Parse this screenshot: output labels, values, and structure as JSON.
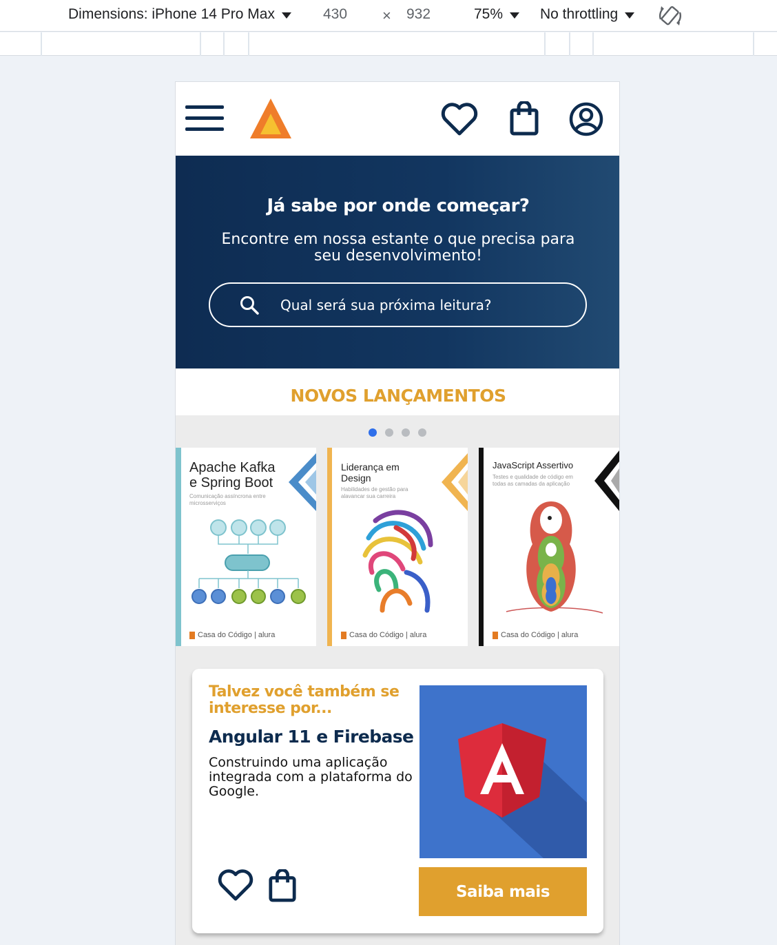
{
  "devtools": {
    "dimensions_label": "Dimensions: iPhone 14 Pro Max",
    "width": "430",
    "times": "×",
    "height": "932",
    "zoom": "75%",
    "throttling": "No throttling",
    "rotate_icon": "rotate-icon"
  },
  "header": {
    "menu_icon": "hamburger-menu-icon",
    "logo_icon": "triangle-logo-icon",
    "favorites_icon": "heart-icon",
    "bag_icon": "shopping-bag-icon",
    "profile_icon": "user-circle-icon"
  },
  "hero": {
    "title": "Já sabe por onde começar?",
    "subtitle": "Encontre em nossa estante o que precisa para seu desenvolvimento!",
    "search_placeholder": "Qual será sua próxima leitura?"
  },
  "releases": {
    "title": "NOVOS LANÇAMENTOS",
    "dots": 4,
    "active_dot": 0,
    "books": [
      {
        "title_line1": "Apache Kafka",
        "title_line2": "e Spring Boot",
        "subtitle": "Comunicação assíncrona entre microsserviços",
        "accent": "#4a8cc9",
        "spine": "#7ec3cd",
        "publisher": "Casa do Código | alura"
      },
      {
        "title_line1": "Liderança em",
        "title_line2": "Design",
        "subtitle": "Habilidades de gestão para alavancar sua carreira",
        "accent": "#f0b450",
        "spine": "#f0b450",
        "publisher": "Casa do Código | alura"
      },
      {
        "title_line1": "JavaScript Assertivo",
        "title_line2": "",
        "subtitle": "Testes e qualidade de código em todas as camadas da aplicação",
        "accent": "#111111",
        "spine": "#111111",
        "publisher": "Casa do Código | alura"
      }
    ]
  },
  "suggestion": {
    "kicker": "Talvez você também se interesse por...",
    "title": "Angular 11 e Firebase",
    "description": "Construindo uma aplicação integrada com a plataforma do Google.",
    "image_icon": "angular-logo-icon",
    "button": "Saiba mais"
  },
  "colors": {
    "navy": "#0d2b4e",
    "gold": "#e0a02e",
    "dot_active": "#2f6fea",
    "angular_bg": "#3e73cb",
    "angular_red": "#dd2c3c"
  }
}
